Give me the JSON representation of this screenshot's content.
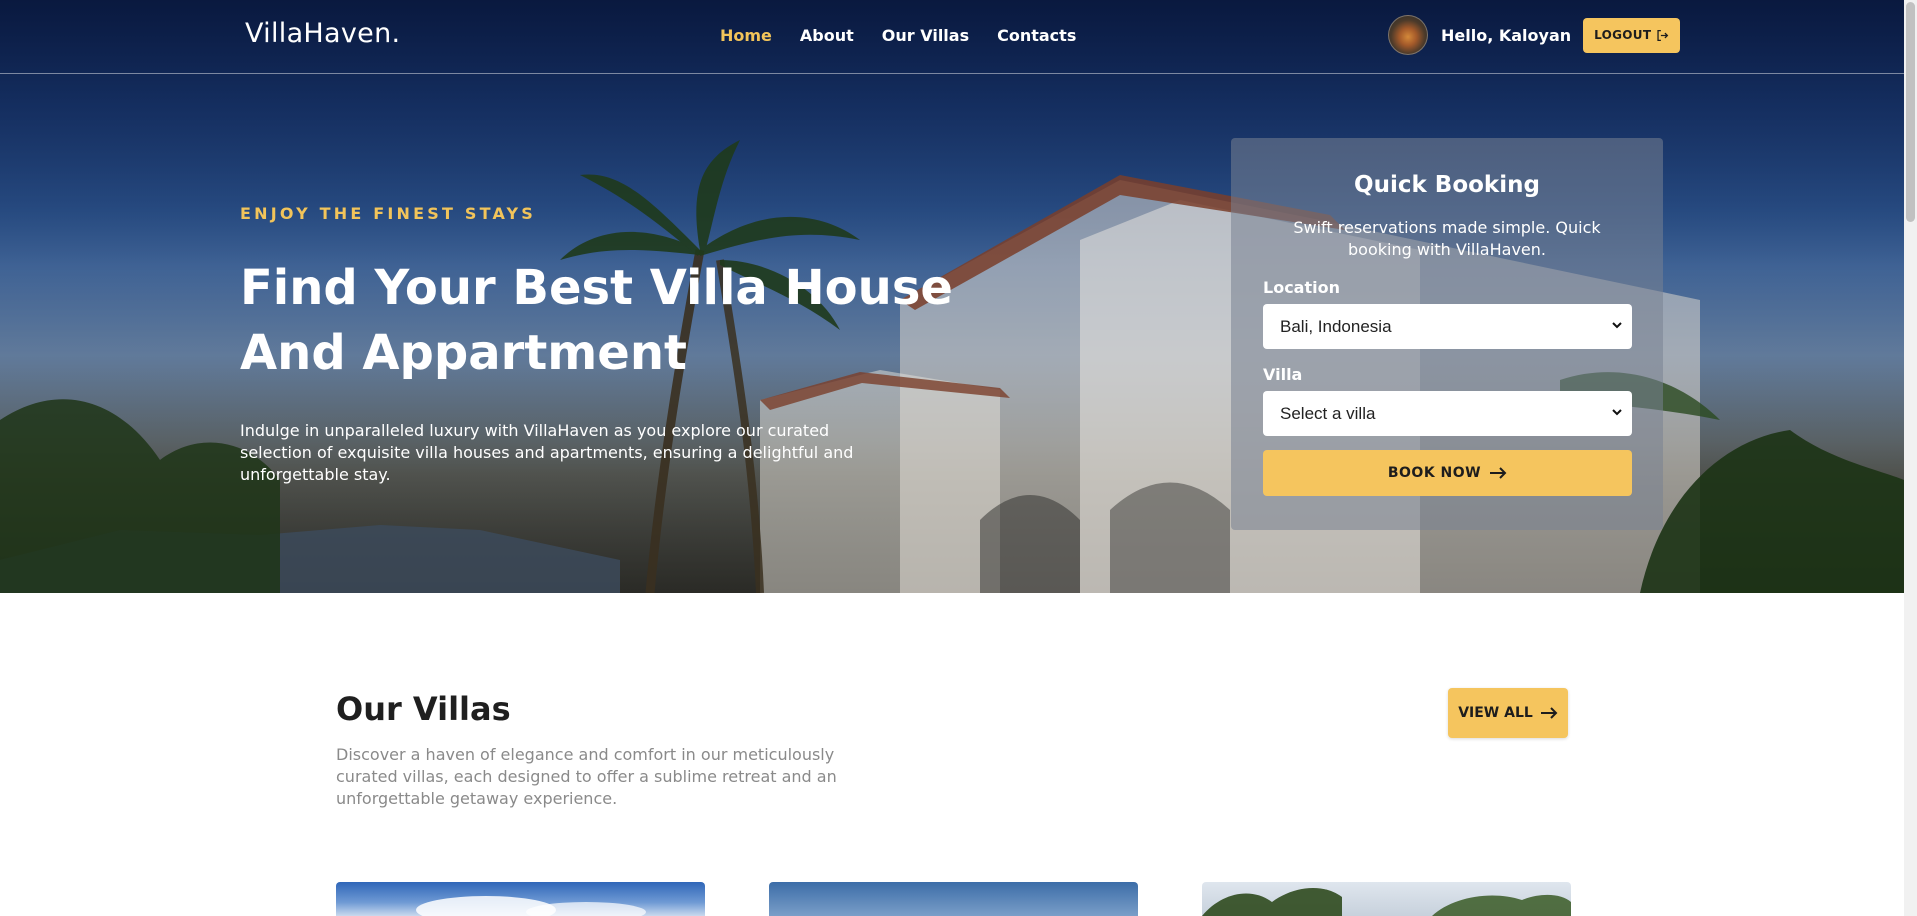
{
  "brand": {
    "logo": "VillaHaven."
  },
  "nav": {
    "items": [
      {
        "label": "Home",
        "active": true
      },
      {
        "label": "About",
        "active": false
      },
      {
        "label": "Our Villas",
        "active": false
      },
      {
        "label": "Contacts",
        "active": false
      }
    ]
  },
  "user": {
    "greeting": "Hello, Kaloyan",
    "logout_label": "LOGOUT"
  },
  "hero": {
    "kicker": "ENJOY THE FINEST STAYS",
    "title": "Find Your Best Villa House And Appartment",
    "description": "Indulge in unparalleled luxury with VillaHaven as you explore our curated selection of exquisite villa houses and apartments, ensuring a delightful and unforgettable stay."
  },
  "booking": {
    "title": "Quick Booking",
    "subtitle": "Swift reservations made simple. Quick booking with VillaHaven.",
    "location_label": "Location",
    "location_value": "Bali, Indonesia",
    "villa_label": "Villa",
    "villa_value": "Select a villa",
    "book_label": "BOOK NOW"
  },
  "villas": {
    "title": "Our Villas",
    "description": "Discover a haven of elegance and comfort in our meticulously curated villas, each designed to offer a sublime retreat and an unforgettable getaway experience.",
    "view_all_label": "VIEW ALL"
  },
  "colors": {
    "accent": "#f5c55e",
    "active_nav": "#f2c45a",
    "navy": "#0e2452"
  }
}
